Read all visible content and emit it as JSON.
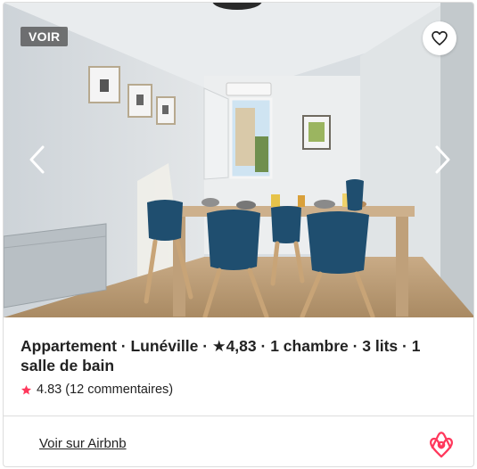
{
  "listing": {
    "badge": "VOIR",
    "title": "Appartement · Lunéville · ★4,83 · 1 chambre · 3 lits · 1 salle de bain",
    "rating_value": "4.83",
    "review_count": "(12 commentaires)",
    "link_label": "Voir sur Airbnb"
  },
  "icons": {
    "favorite": "heart-outline-icon",
    "previous": "chevron-left-icon",
    "next": "chevron-right-icon",
    "rating": "star-icon",
    "brand": "airbnb-logo"
  },
  "colors": {
    "accent": "#ff385c",
    "text": "#222222",
    "divider": "#dddddd"
  }
}
